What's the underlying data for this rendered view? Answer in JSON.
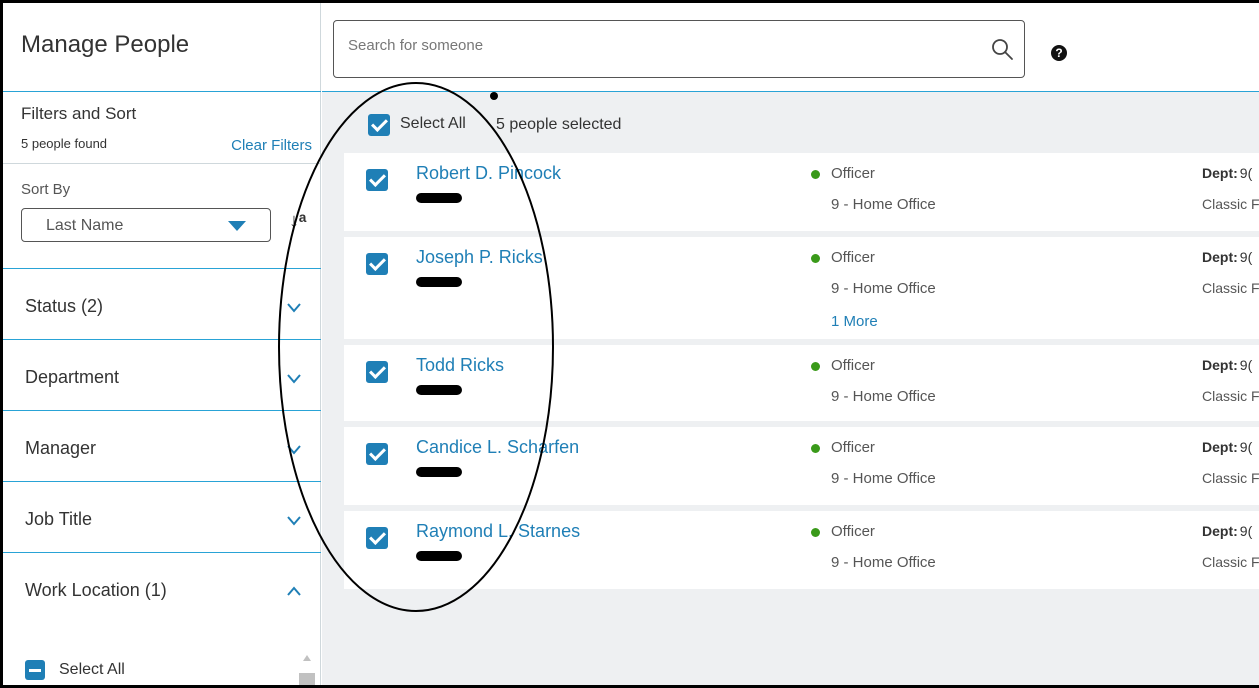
{
  "app": {
    "title": "Manage People"
  },
  "search": {
    "placeholder": "Search for someone",
    "value": ""
  },
  "header": {
    "help_icon": "question-circle-icon",
    "help_glyph": "?"
  },
  "sidebar": {
    "filters_title": "Filters and Sort",
    "people_found": "5 people found",
    "clear_filters": "Clear Filters",
    "sort_by_label": "Sort By",
    "sort_by_value": "Last Name",
    "sort_direction_icon": "sort-alpha-ascending-icon",
    "sort_direction_glyph": "↓ᵃ",
    "sections": [
      {
        "label": "Status (2)",
        "expanded": false
      },
      {
        "label": "Department",
        "expanded": false
      },
      {
        "label": "Manager",
        "expanded": false
      },
      {
        "label": "Job Title",
        "expanded": false
      },
      {
        "label": "Work Location (1)",
        "expanded": true
      }
    ],
    "work_location_select_all": "Select All"
  },
  "main": {
    "select_all_label": "Select All",
    "selected_count": "5 people selected",
    "people": [
      {
        "name": "Robert D. Pincock",
        "status": "Officer",
        "location": "9 - Home Office",
        "dept_label": "Dept:",
        "dept_value": "9(",
        "extra": "Classic F",
        "more": ""
      },
      {
        "name": "Joseph P. Ricks",
        "status": "Officer",
        "location": "9 - Home Office",
        "dept_label": "Dept:",
        "dept_value": "9(",
        "extra": "Classic F",
        "more": "1 More"
      },
      {
        "name": "Todd Ricks",
        "status": "Officer",
        "location": "9 - Home Office",
        "dept_label": "Dept:",
        "dept_value": "9(",
        "extra": "Classic F",
        "more": ""
      },
      {
        "name": "Candice L. Scharfen",
        "status": "Officer",
        "location": "9 - Home Office",
        "dept_label": "Dept:",
        "dept_value": "9(",
        "extra": "Classic F",
        "more": ""
      },
      {
        "name": "Raymond L. Starnes",
        "status": "Officer",
        "location": "9 - Home Office",
        "dept_label": "Dept:",
        "dept_value": "9(",
        "extra": "Classic F",
        "more": ""
      }
    ]
  },
  "colors": {
    "accent": "#1f7fb6",
    "status_active": "#3a9a1a",
    "rule": "#29a3d6",
    "main_bg": "#eef0f2"
  }
}
